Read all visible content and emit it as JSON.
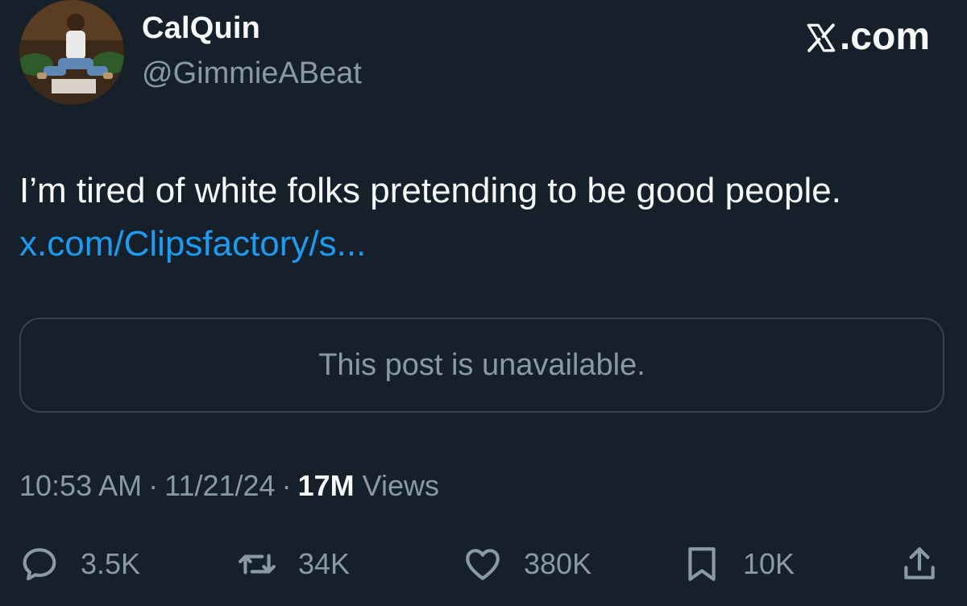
{
  "author": {
    "display_name": "CalQuin",
    "handle": "@GimmieABeat",
    "avatar": "profile-photo"
  },
  "brand": {
    "label": ".com",
    "icon": "x-logo-icon"
  },
  "tweet": {
    "text": "I’m tired of white folks pretending to be good people.",
    "link": "x.com/Clipsfactory/s..."
  },
  "quoted_post": {
    "message": "This post is unavailable."
  },
  "meta": {
    "time": "10:53 AM",
    "separator": "·",
    "date": "11/21/24",
    "views_count": "17M",
    "views_label": "Views"
  },
  "actions": {
    "reply": {
      "icon": "reply-icon",
      "count": "3.5K"
    },
    "repost": {
      "icon": "repost-icon",
      "count": "34K"
    },
    "like": {
      "icon": "heart-icon",
      "count": "380K"
    },
    "bookmark": {
      "icon": "bookmark-icon",
      "count": "10K"
    },
    "share": {
      "icon": "share-icon"
    }
  },
  "colors": {
    "background": "#15202b",
    "primary_text": "#f7f9f9",
    "secondary_text": "#8b98a5",
    "link": "#1d9bf0",
    "border": "#38444d"
  }
}
